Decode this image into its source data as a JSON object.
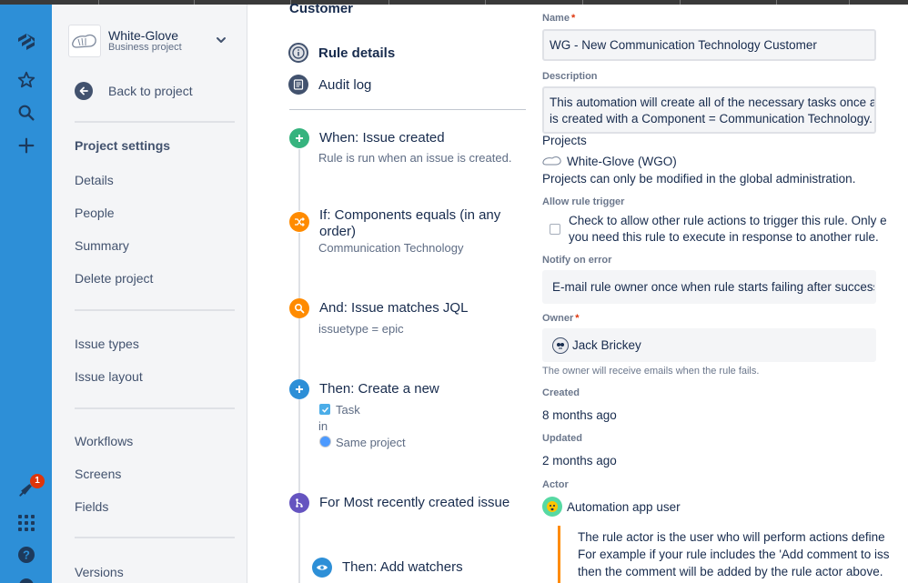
{
  "colors": {
    "rail": "#2d8fd7",
    "sidebar": "#f4f5f7",
    "trigger": "#36b37e",
    "condition": "#ff8b00",
    "action": "#2d8fd7",
    "branch": "#6554c0",
    "badge": "#de350b"
  },
  "global_nav": {
    "icons": [
      "logo-icon",
      "star-icon",
      "search-icon",
      "plus-icon",
      "notification-icon",
      "app-switcher-icon",
      "help-icon"
    ],
    "notification_count": "1"
  },
  "sidebar": {
    "project_name": "White-Glove",
    "project_type": "Business project",
    "back_label": "Back to project",
    "settings_title": "Project settings",
    "items_group1": [
      "Details",
      "People",
      "Summary",
      "Delete project"
    ],
    "items_group2": [
      "Issue types",
      "Issue layout"
    ],
    "items_group3": [
      "Workflows",
      "Screens",
      "Fields"
    ],
    "items_group4": [
      "Versions"
    ]
  },
  "rule": {
    "partial_heading": "Customer",
    "tabs": [
      {
        "label": "Rule details",
        "icon": "info-icon"
      },
      {
        "label": "Audit log",
        "icon": "log-icon"
      }
    ],
    "steps": [
      {
        "title": "When: Issue created",
        "sub": "Rule is run when an issue is created."
      },
      {
        "title": "If: Components equals (in any order)",
        "sub": "Communication Technology"
      },
      {
        "title": "And: Issue matches JQL",
        "sub": "issuetype = epic"
      },
      {
        "title": "Then: Create a new",
        "type": "Task",
        "in": "in",
        "project": "Same project"
      },
      {
        "title": "For Most recently created issue"
      },
      {
        "title": "Then: Add watchers"
      }
    ]
  },
  "details": {
    "name_label": "Name",
    "name_value": "WG - New Communication Technology Customer",
    "description_label": "Description",
    "description_line1": "This automation will create all of the necessary tasks once a n",
    "description_line2": "is created with a Component = Communication Technology.",
    "projects_label": "Projects",
    "project_value": "White-Glove (WGO)",
    "projects_note": "Projects can only be modified in the global administration.",
    "allow_trigger_label": "Allow rule trigger",
    "allow_trigger_line1": "Check to allow other rule actions to trigger this rule. Only e",
    "allow_trigger_line2": "you need this rule to execute in response to another rule.",
    "notify_label": "Notify on error",
    "notify_value": "E-mail rule owner once when rule starts failing after success",
    "owner_label": "Owner",
    "owner_value": "Jack Brickey",
    "owner_help": "The owner will receive emails when the rule fails.",
    "created_label": "Created",
    "created_value": "8 months ago",
    "updated_label": "Updated",
    "updated_value": "2 months ago",
    "actor_label": "Actor",
    "actor_value": "Automation app user",
    "actor_note1": "The rule actor is the user who will perform actions define",
    "actor_note2": "For example if your rule includes the 'Add comment to iss",
    "actor_note3": "then the comment will be added by the rule actor above.",
    "required_mark": "*"
  }
}
